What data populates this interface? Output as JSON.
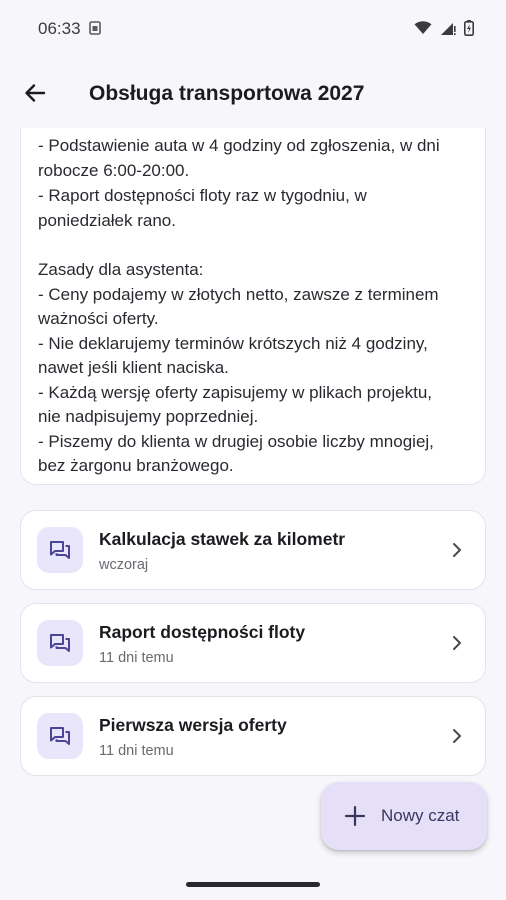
{
  "status_bar": {
    "time": "06:33",
    "icons": [
      "sim-card-icon",
      "wifi-icon",
      "signal-icon",
      "battery-icon"
    ]
  },
  "app_bar": {
    "back_icon": "arrow-left-icon",
    "title": "Obsługa transportowa 2027"
  },
  "note": {
    "lines": [
      "- Podstawienie auta w 4 godziny od zgłoszenia, w dni",
      "robocze 6:00-20:00.",
      "- Raport dostępności floty raz w tygodniu, w",
      "poniedziałek rano.",
      "",
      "Zasady dla asystenta:",
      "- Ceny podajemy w złotych netto, zawsze z terminem",
      "ważności oferty.",
      "- Nie deklarujemy terminów krótszych niż 4 godziny,",
      "nawet jeśli klient naciska.",
      "- Każdą wersję oferty zapisujemy w plikach projektu,",
      "nie nadpisujemy poprzedniej.",
      "- Piszemy do klienta w drugiej osobie liczby mnogiej,",
      "bez żargonu branżowego."
    ]
  },
  "chats": [
    {
      "title": "Kalkulacja stawek za kilometr",
      "subtitle": "wczoraj",
      "icon": "chat-bubbles-icon"
    },
    {
      "title": "Raport dostępności floty",
      "subtitle": "11 dni temu",
      "icon": "chat-bubbles-icon"
    },
    {
      "title": "Pierwsza wersja oferty",
      "subtitle": "11 dni temu",
      "icon": "chat-bubbles-icon"
    }
  ],
  "fab": {
    "label": "Nowy czat",
    "icon": "plus-icon"
  },
  "colors": {
    "background": "#f7f7fb",
    "icon_tile": "#e9e5fb",
    "icon_accent": "#4b4598",
    "fab_bg": "#e5e0f8"
  }
}
